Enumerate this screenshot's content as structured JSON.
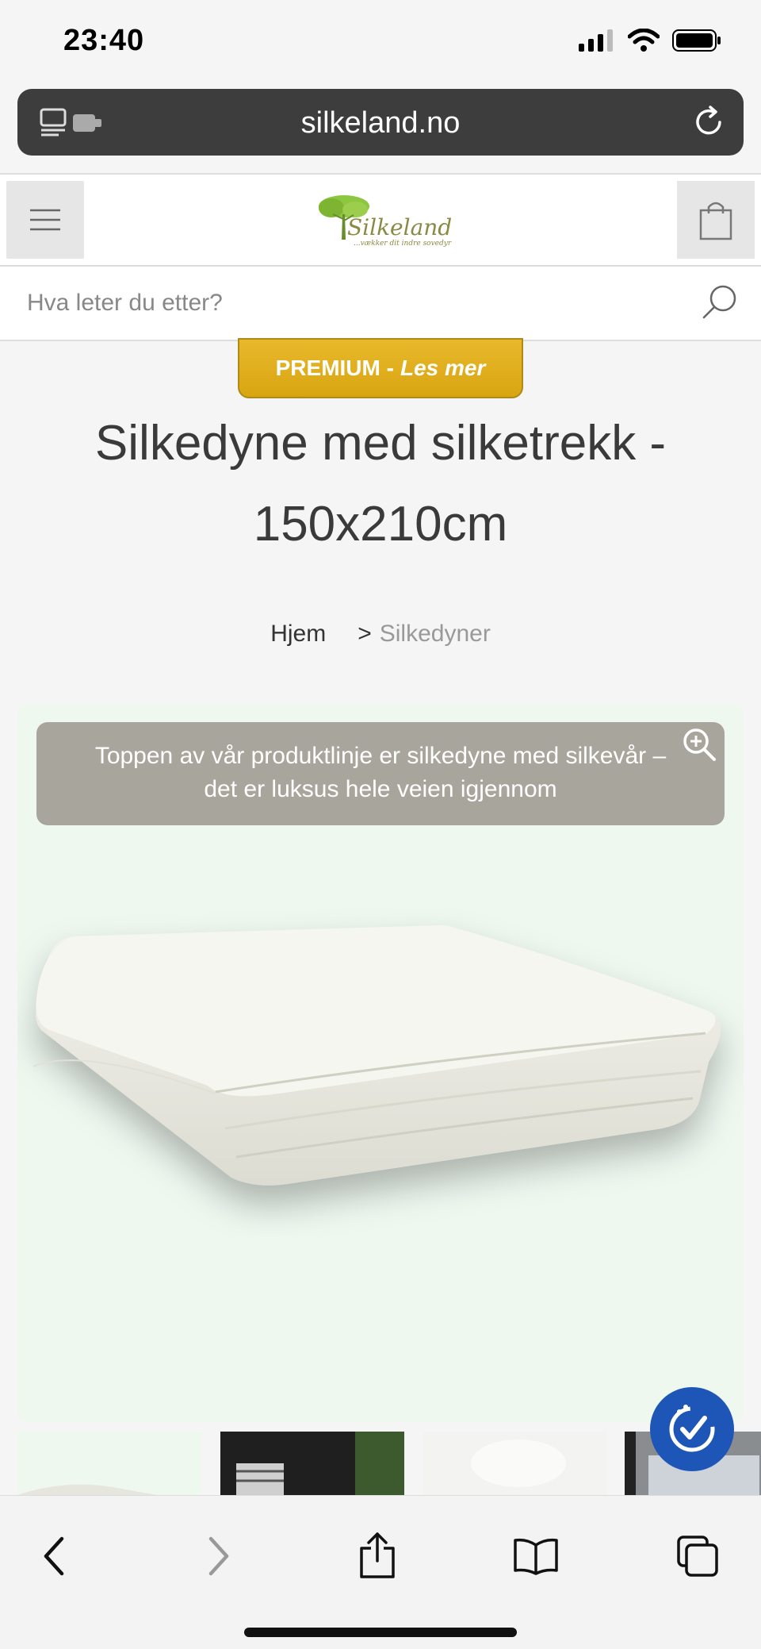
{
  "status_bar": {
    "time": "23:40"
  },
  "browser": {
    "url": "silkeland.no"
  },
  "site": {
    "logo_text": "Silkeland",
    "logo_tagline": "...vækker dit indre sovedyr",
    "search_placeholder": "Hva leter du etter?"
  },
  "product": {
    "badge_label": "PREMIUM -",
    "badge_link": "Les mer",
    "title": "Silkedyne med silketrekk - 150x210cm",
    "breadcrumb": {
      "home": "Hjem",
      "separator": ">",
      "current": "Silkedyner"
    },
    "image_caption": "Toppen av vår produktlinje er silkedyne med silkevår – det er luksus hele veien igjennom"
  },
  "colors": {
    "accent_gold": "#e2b21f",
    "gallery_bg": "#eef8ef",
    "caption_bg": "#a8a69c",
    "accessibility_blue": "#1e56b8"
  },
  "icons": {
    "menu": "hamburger-icon",
    "cart": "shopping-bag-icon",
    "search": "search-icon",
    "zoom": "zoom-in-icon",
    "accessibility": "accessibility-icon",
    "back": "chevron-left-icon",
    "forward": "chevron-right-icon",
    "share": "share-icon",
    "bookmarks": "book-icon",
    "tabs": "tabs-icon"
  }
}
